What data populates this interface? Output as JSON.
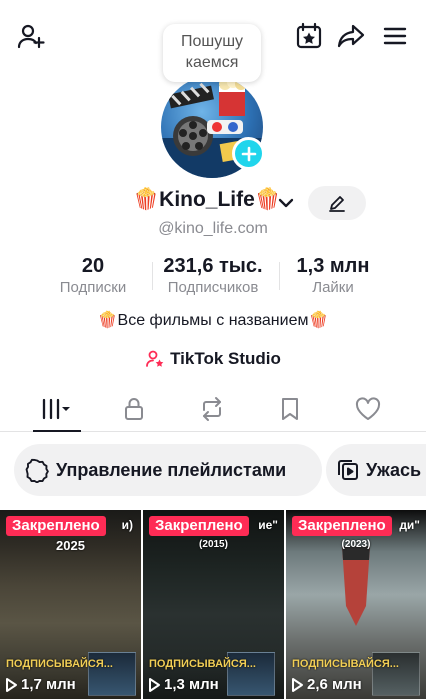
{
  "profile": {
    "note": "Пошушу каемся",
    "username": "🍿Kino_Life🍿",
    "handle": "@kino_life.com",
    "bio": "🍿Все фильмы с названием🍿",
    "studio_label": "TikTok Studio"
  },
  "stats": {
    "following_count": "20",
    "following_label": "Подписки",
    "followers_count": "231,6 тыс.",
    "followers_label": "Подписчиков",
    "likes_count": "1,3 млн",
    "likes_label": "Лайки"
  },
  "chips": {
    "playlists_label": "Управление плейлистами",
    "horror_label": "Ужась"
  },
  "videos": [
    {
      "pinned_label": "Закреплено",
      "title_fragment": "и)",
      "year": "2025",
      "subtitle": "ПОДПИСЫВАЙСЯ...",
      "views": "1,7 млн"
    },
    {
      "pinned_label": "Закреплено",
      "title_fragment": "ие\"",
      "year": "(2015)",
      "subtitle": "ПОДПИСЫВАЙСЯ...",
      "views": "1,3 млн"
    },
    {
      "pinned_label": "Закреплено",
      "title_fragment": "ди\"",
      "year": "(2023)",
      "subtitle": "ПОДПИСЫВАЙСЯ...",
      "views": "2,6 млн"
    }
  ],
  "colors": {
    "accent_cyan": "#20d5ec",
    "pin_red": "#fe2c55",
    "text_primary": "#161823",
    "text_secondary": "#8a8b91"
  },
  "icons": [
    "add-friend-icon",
    "calendar-star-icon",
    "share-icon",
    "menu-icon",
    "plus-icon",
    "chevron-down-icon",
    "pencil-icon",
    "studio-person-icon",
    "videos-grid-icon",
    "lock-icon",
    "repost-icon",
    "bookmark-icon",
    "heart-icon",
    "gear-icon",
    "playlist-icon",
    "play-icon"
  ]
}
